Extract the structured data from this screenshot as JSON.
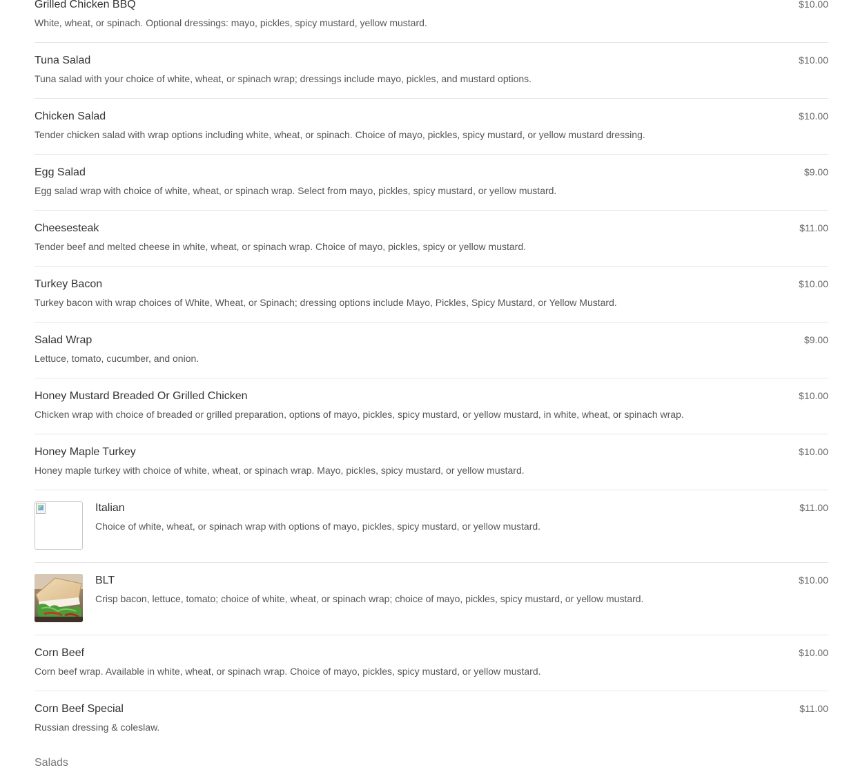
{
  "menu": {
    "items": [
      {
        "name": "Grilled Chicken BBQ",
        "description": "White, wheat, or spinach. Optional dressings: mayo, pickles, spicy mustard, yellow mustard.",
        "price": "$10.00"
      },
      {
        "name": "Tuna Salad",
        "description": "Tuna salad with your choice of white, wheat, or spinach wrap; dressings include mayo, pickles, and mustard options.",
        "price": "$10.00"
      },
      {
        "name": "Chicken Salad",
        "description": "Tender chicken salad with wrap options including white, wheat, or spinach. Choice of mayo, pickles, spicy mustard, or yellow mustard dressing.",
        "price": "$10.00"
      },
      {
        "name": "Egg Salad",
        "description": "Egg salad wrap with choice of white, wheat, or spinach wrap. Select from mayo, pickles, spicy mustard, or yellow mustard.",
        "price": "$9.00"
      },
      {
        "name": "Cheesesteak",
        "description": "Tender beef and melted cheese in white, wheat, or spinach wrap. Choice of mayo, pickles, spicy or yellow mustard.",
        "price": "$11.00"
      },
      {
        "name": "Turkey Bacon",
        "description": "Turkey bacon with wrap choices of White, Wheat, or Spinach; dressing options include Mayo, Pickles, Spicy Mustard, or Yellow Mustard.",
        "price": "$10.00"
      },
      {
        "name": "Salad Wrap",
        "description": "Lettuce, tomato, cucumber, and onion.",
        "price": "$9.00"
      },
      {
        "name": "Honey Mustard Breaded Or Grilled Chicken",
        "description": "Chicken wrap with choice of breaded or grilled preparation, options of mayo, pickles, spicy mustard, or yellow mustard, in white, wheat, or spinach wrap.",
        "price": "$10.00"
      },
      {
        "name": "Honey Maple Turkey",
        "description": "Honey maple turkey with choice of white, wheat, or spinach wrap. Mayo, pickles, spicy mustard, or yellow mustard.",
        "price": "$10.00"
      },
      {
        "name": "Italian",
        "description": "Choice of white, wheat, or spinach wrap with options of mayo, pickles, spicy mustard, or yellow mustard.",
        "price": "$11.00",
        "image": "broken-image-icon"
      },
      {
        "name": "BLT",
        "description": "Crisp bacon, lettuce, tomato; choice of white, wheat, or spinach wrap; choice of mayo, pickles, spicy mustard, or yellow mustard.",
        "price": "$10.00",
        "image": "blt-photo"
      },
      {
        "name": "Corn Beef",
        "description": "Corn beef wrap. Available in white, wheat, or spinach wrap. Choice of mayo, pickles, spicy mustard, or yellow mustard.",
        "price": "$10.00"
      },
      {
        "name": "Corn Beef Special",
        "description": "Russian dressing & coleslaw.",
        "price": "$11.00"
      }
    ]
  },
  "next_section": {
    "title": "Salads"
  }
}
